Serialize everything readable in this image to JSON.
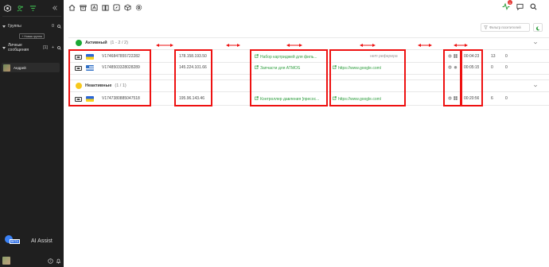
{
  "sidebar": {
    "groups_label": "Группы",
    "groups_count": "0",
    "new_group_label": "+ Новая группа",
    "private_label": "Личные сообщения",
    "private_count": "[1]",
    "contact_name": "Андрей",
    "ai_assist_label": "AI Assist",
    "ai_badge": "BETA"
  },
  "toolbar": {
    "icons": [
      "home-icon",
      "archive-icon",
      "translate-icon",
      "book-icon",
      "compass-icon",
      "cube-icon",
      "settings-icon"
    ],
    "notification_count": "1"
  },
  "filter": {
    "placeholder": "Фильтр посетителей"
  },
  "sections": {
    "active": {
      "label": "Активный",
      "count": "(1 - 2 / 2)",
      "color": "#1aa834"
    },
    "inactive": {
      "label": "Неактивные",
      "count": "(1 / 1)",
      "color": "#f7c81c"
    }
  },
  "rows": [
    {
      "flag": "ua",
      "visitor_id": "V1746847855722282",
      "ip": "178.158.193.50",
      "page": "Набор картриджей для филь...",
      "referrer": "нет реферера",
      "time": "00:04:23",
      "n1": "13",
      "n2": "0"
    },
    {
      "flag": "gr",
      "visitor_id": "V1748503328028289",
      "ip": "145.224.101.66",
      "page": "Запчасти для ATMOS",
      "referrer": "https://www.google.com/",
      "time": "00:05:15",
      "n1": "0",
      "n2": "0"
    },
    {
      "flag": "ua",
      "visitor_id": "V1747380885047518",
      "ip": "195.96.143.46",
      "page": "Контроллер давления [пресос...",
      "referrer": "https://www.google.com/",
      "time": "00:20:56",
      "n1": "6",
      "n2": "0"
    }
  ],
  "annotation_color": "#e11111"
}
